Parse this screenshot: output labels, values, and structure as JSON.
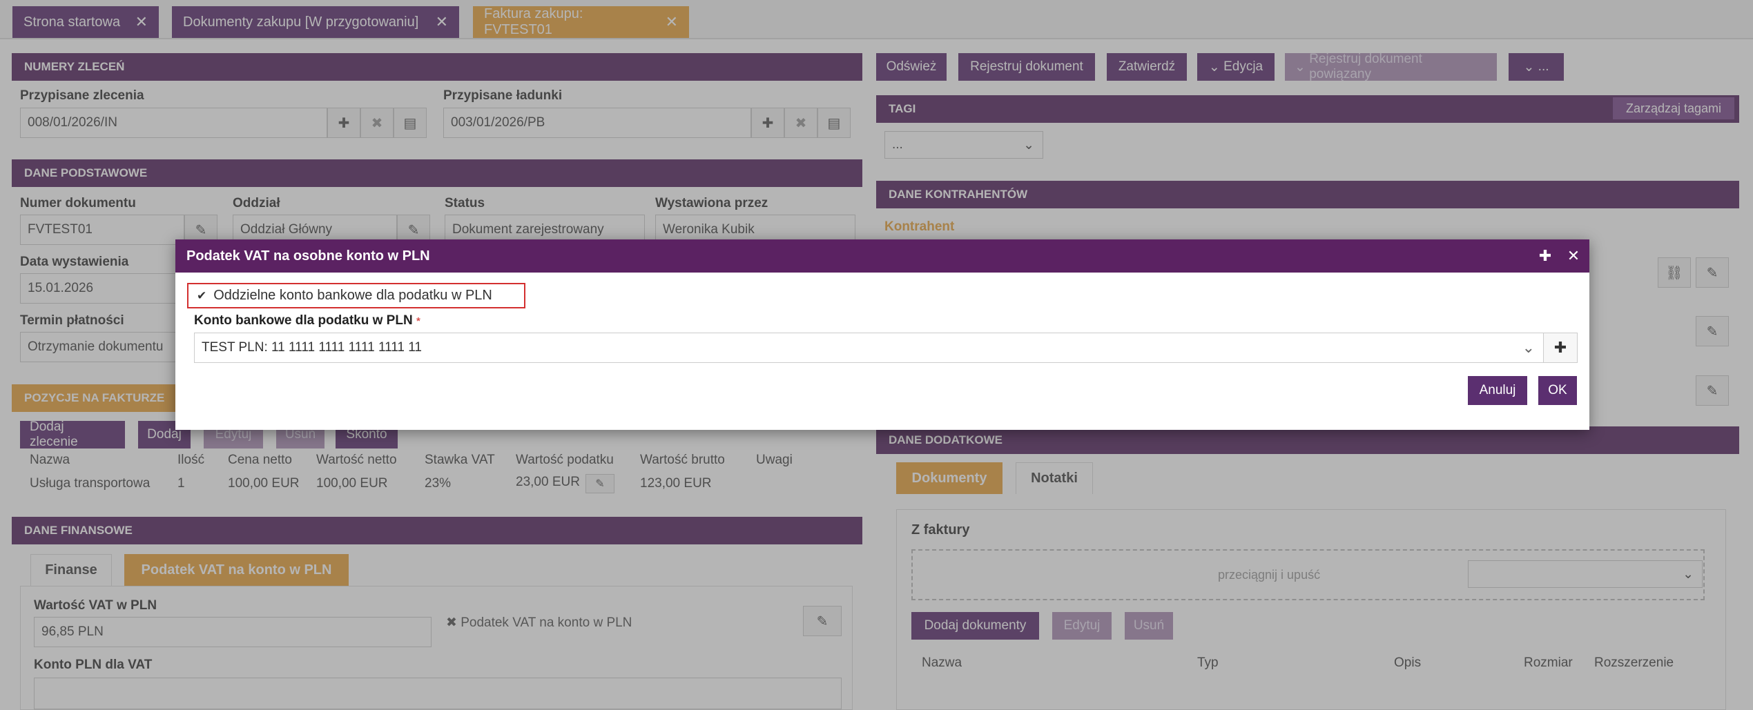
{
  "tabs": [
    {
      "label": "Strona startowa"
    },
    {
      "label": "Dokumenty zakupu [W przygotowaniu]"
    },
    {
      "label": "Faktura zakupu: FVTEST01"
    }
  ],
  "orders": {
    "header": "NUMERY ZLECEŃ",
    "assigned_orders_label": "Przypisane zlecenia",
    "assigned_orders_value": "008/01/2026/IN",
    "assigned_loads_label": "Przypisane ładunki",
    "assigned_loads_value": "003/01/2026/PB"
  },
  "toolbar": {
    "refresh": "Odśwież",
    "register": "Rejestruj dokument",
    "approve": "Zatwierdź",
    "edit": "Edycja",
    "register_related": "Rejestruj dokument powiązany",
    "more": "..."
  },
  "tags": {
    "header": "TAGI",
    "manage": "Zarządzaj tagami",
    "select_value": "..."
  },
  "basic": {
    "header": "DANE PODSTAWOWE",
    "doc_number_label": "Numer dokumentu",
    "doc_number_value": "FVTEST01",
    "branch_label": "Oddział",
    "branch_value": "Oddział Główny",
    "status_label": "Status",
    "status_value": "Dokument zarejestrowany",
    "issued_by_label": "Wystawiona przez",
    "issued_by_value": "Weronika Kubik",
    "issue_date_label": "Data wystawienia",
    "issue_date_value": "15.01.2026",
    "payment_term_label": "Termin płatności",
    "payment_term_value": "Otrzymanie dokumentu"
  },
  "contractors": {
    "header": "DANE KONTRAHENTÓW",
    "contractor_label": "Kontrahent"
  },
  "items": {
    "header": "POZYCJE NA FAKTURZE",
    "buttons": {
      "add_order": "Dodaj zlecenie",
      "add": "Dodaj",
      "edit": "Edytuj",
      "delete": "Usuń",
      "discount": "Skonto"
    },
    "columns": [
      "Nazwa",
      "Ilość",
      "Cena netto",
      "Wartość netto",
      "Stawka VAT",
      "Wartość podatku",
      "Wartość brutto",
      "Uwagi"
    ],
    "row": {
      "name": "Usługa transportowa",
      "qty": "1",
      "net_price": "100,00 EUR",
      "net_value": "100,00 EUR",
      "vat_rate": "23%",
      "tax_value": "23,00 EUR",
      "gross_value": "123,00 EUR"
    }
  },
  "finance": {
    "header": "DANE FINANSOWE",
    "tab_finance": "Finanse",
    "tab_vat": "Podatek VAT na konto w PLN",
    "vat_pln_label": "Wartość VAT w PLN",
    "vat_pln_value": "96,85 PLN",
    "vat_account_flag": "Podatek VAT na konto w PLN",
    "pln_account_label": "Konto PLN dla VAT"
  },
  "additional": {
    "header": "DANE DODATKOWE",
    "tab_documents": "Dokumenty",
    "tab_notes": "Notatki",
    "from_invoice": "Z faktury",
    "dropzone": "przeciągnij i upuść",
    "add_docs": "Dodaj dokumenty",
    "edit": "Edytuj",
    "delete": "Usuń",
    "columns": [
      "Nazwa",
      "Typ",
      "Opis",
      "Rozmiar",
      "Rozszerzenie"
    ]
  },
  "dialog": {
    "title": "Podatek VAT na osobne konto w PLN",
    "checkbox_label": "Oddzielne konto bankowe dla podatku w PLN",
    "checkbox_checked": true,
    "account_label": "Konto bankowe dla podatku w PLN",
    "required_mark": "*",
    "account_value": "TEST PLN: 11 1111 1111 1111 1111 11",
    "cancel": "Anuluj",
    "ok": "OK"
  },
  "colors": {
    "purple": "#5b2f70",
    "orange": "#e8a33d",
    "required": "#d9534f",
    "highlight": "#d32f2f"
  }
}
